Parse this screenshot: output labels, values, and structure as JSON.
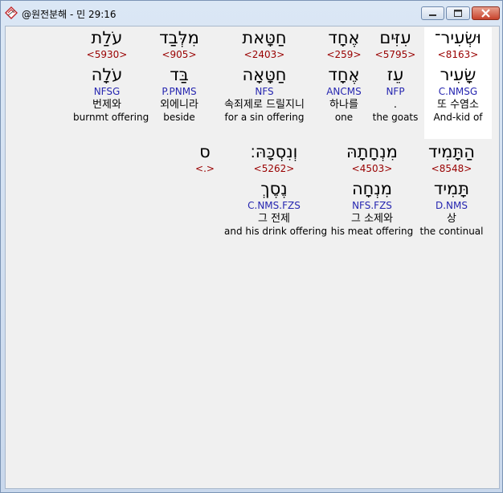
{
  "window": {
    "title": "@원전분해 - 민 29:16"
  },
  "row1": [
    {
      "heb": "וּשְׂעִיר־",
      "strong": "<8163>",
      "lemma": "שָׂעִיר",
      "morph": "C.NMSG",
      "kor": "또 수염소",
      "eng": "And-kid of",
      "hl": true
    },
    {
      "heb": "עִזִּים",
      "strong": "<5795>",
      "lemma": "עֵז",
      "morph": "NFP",
      "kor": ".",
      "eng": "the goats",
      "hl": false
    },
    {
      "heb": "אֶחָד",
      "strong": "<259>",
      "lemma": "אֶחָד",
      "morph": "ANCMS",
      "kor": "하나를",
      "eng": "one",
      "hl": false
    },
    {
      "heb": "חַטָּאת",
      "strong": "<2403>",
      "lemma": "חַטָּאָה",
      "morph": "NFS",
      "kor": "속죄제로 드릴지니",
      "eng": "for a sin offering",
      "hl": false
    },
    {
      "heb": "מִלְּבַד",
      "strong": "<905>",
      "lemma": "בַּד",
      "morph": "P.PNMS",
      "kor": "외에니라",
      "eng": "beside",
      "hl": false
    },
    {
      "heb": "עֹלַת",
      "strong": "<5930>",
      "lemma": "עֹלָה",
      "morph": "NFSG",
      "kor": "번제와",
      "eng": "burnmt offering",
      "hl": false
    }
  ],
  "row2": [
    {
      "heb": "הַתָּמִיד",
      "strong": "<8548>",
      "lemma": "תָּמִיד",
      "morph": "D.NMS",
      "kor": "상",
      "eng": "the continual"
    },
    {
      "heb": "מִנְחָתָהּ",
      "strong": "<4503>",
      "lemma": "מִנְחָה",
      "morph": "NFS.FZS",
      "kor": "그 소제와",
      "eng": "his meat offering"
    },
    {
      "heb": "וְנִסְכָּהּ׃",
      "strong": "<5262>",
      "lemma": "נֶסֶךְ",
      "morph": "C.NMS.FZS",
      "kor": "그 전제",
      "eng": "and his drink offering"
    },
    {
      "heb": "ס",
      "strong": "<.>",
      "lemma": "",
      "morph": "",
      "kor": "",
      "eng": ""
    }
  ]
}
